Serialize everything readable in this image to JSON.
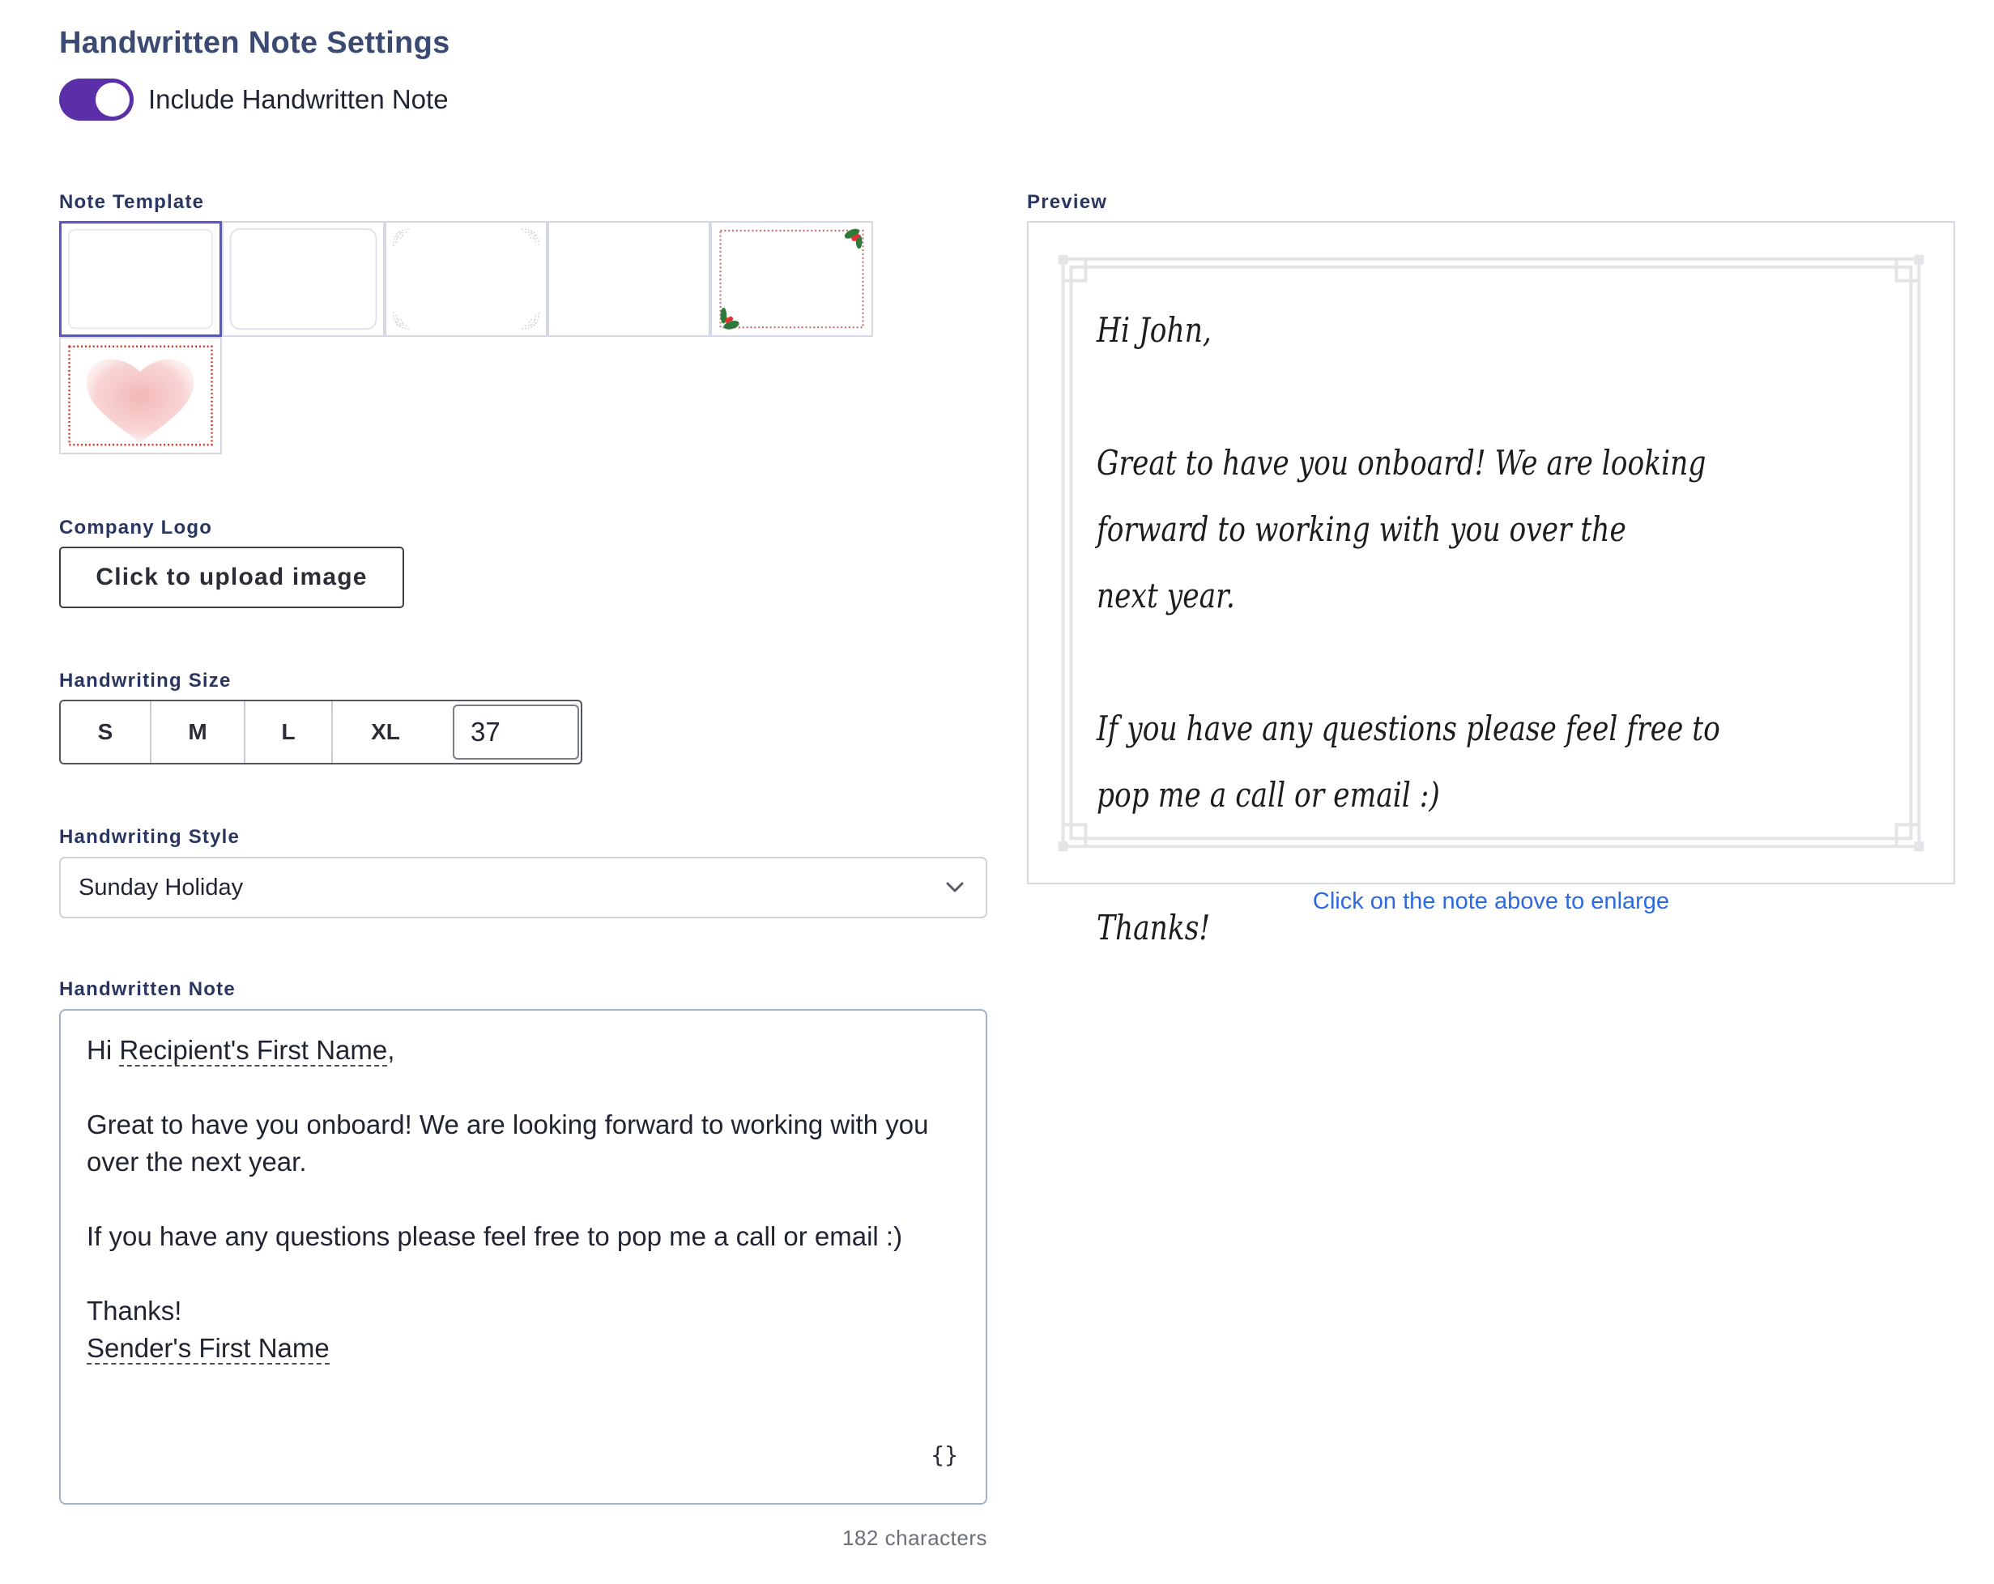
{
  "header": {
    "title": "Handwritten Note Settings"
  },
  "toggle": {
    "label": "Include Handwritten Note",
    "on": true
  },
  "template_section": {
    "label": "Note Template",
    "templates": [
      "plain",
      "rounded",
      "lace-corners",
      "blank",
      "holly-dotted",
      "heart-watercolor"
    ],
    "selected": "plain"
  },
  "logo": {
    "label": "Company Logo",
    "button_label": "Click to upload image"
  },
  "size": {
    "label": "Handwriting Size",
    "options": [
      "S",
      "M",
      "L",
      "XL"
    ],
    "value": "37"
  },
  "style": {
    "label": "Handwriting Style",
    "selected": "Sunday Holiday"
  },
  "note": {
    "label": "Handwritten Note",
    "greeting_prefix": "Hi ",
    "recipient_token": "Recipient's First Name",
    "greeting_suffix": ",",
    "para1": "Great to have you onboard! We are looking forward to working with you over the next year.",
    "para2": "If you have any questions please feel free to pop me a call or email :)",
    "closing": "Thanks!",
    "sender_token": "Sender's First Name",
    "variables_icon": "{}",
    "char_count": "182 characters"
  },
  "preview": {
    "label": "Preview",
    "greeting": "Hi John,",
    "line1": "Great to have you onboard! We are looking forward to working with you over the",
    "line2": "next year.",
    "line3": "If you have any questions please feel free to pop me a call or email :)",
    "closing": "Thanks!",
    "enlarge_link": "Click on the note above to enlarge"
  },
  "colors": {
    "accent": "#5b2fa8",
    "link": "#2d6ae0",
    "heading": "#3b4a73"
  }
}
